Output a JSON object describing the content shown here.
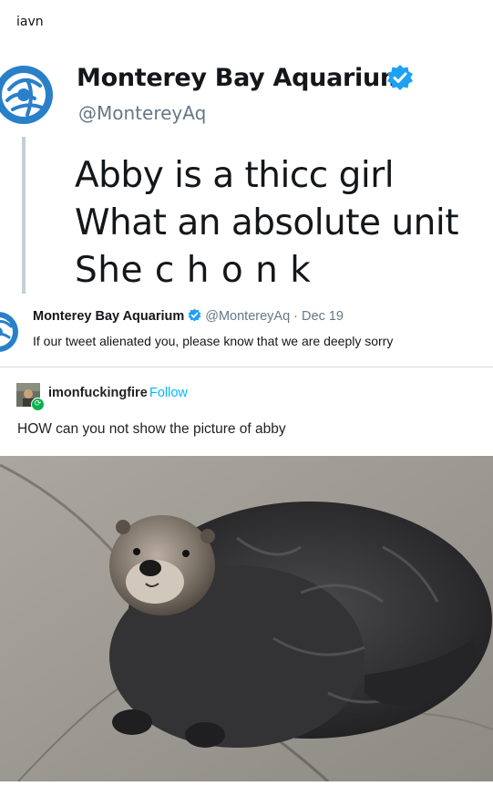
{
  "top_user": "iavn",
  "tweet1": {
    "account_name": "Monterey Bay Aquarium",
    "handle": "@MontereyAq",
    "lines": [
      "Abby is a thicc girl",
      "What an absolute unit",
      "She c h o n k"
    ],
    "verified_icon": "verified-badge-icon"
  },
  "tweet2": {
    "account_name": "Monterey Bay Aquarium",
    "meta": "@MontereyAq · Dec 19",
    "body": "If our tweet alienated you, please know that we are deeply sorry"
  },
  "reblog": {
    "username": "imonfuckingfire",
    "follow_label": "Follow",
    "text": "HOW can you not show the picture of abby"
  },
  "colors": {
    "twitter_blue": "#1da1f2",
    "tumblr_follow": "#00b8ff",
    "reblog_green": "#00b34a",
    "logo_blue": "#2a7fc9"
  }
}
